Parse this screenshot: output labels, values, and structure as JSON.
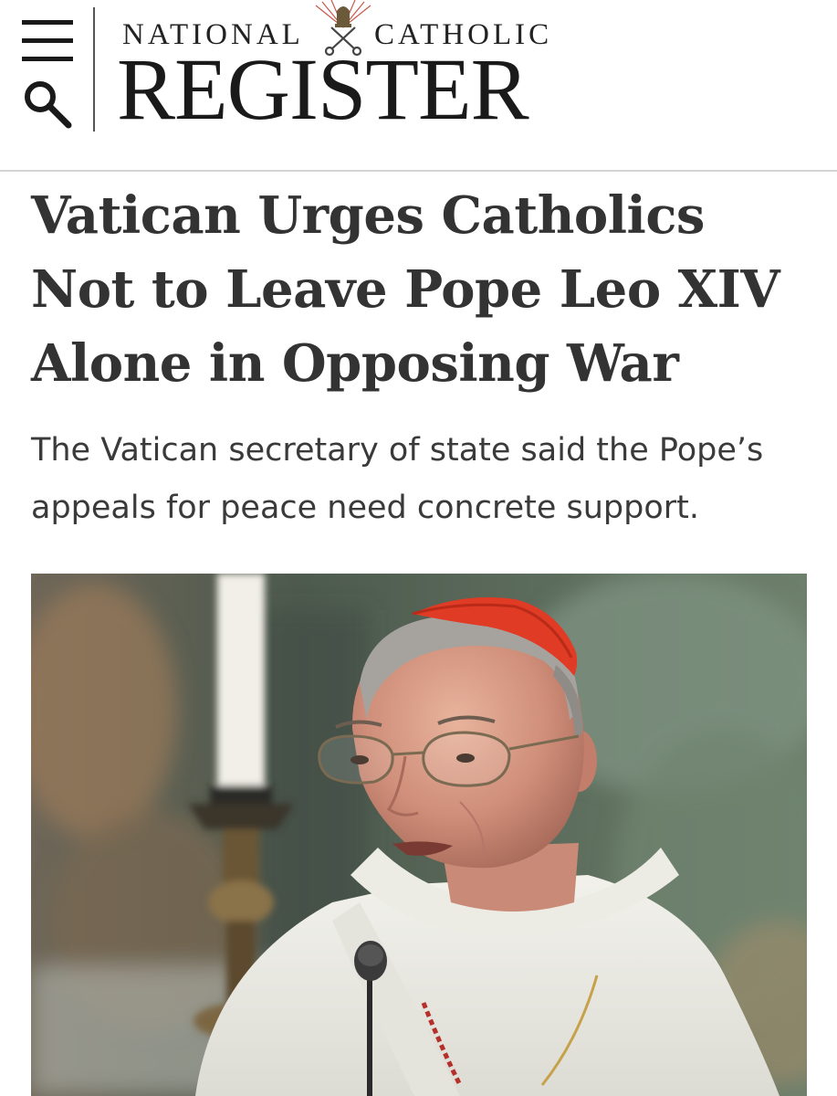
{
  "header": {
    "masthead_top_left": "NATIONAL",
    "masthead_top_right": "CATHOLIC",
    "masthead_main": "REGISTER",
    "menu_icon": "hamburger-menu-icon",
    "search_icon": "search-icon",
    "emblem_icon": "papal-keys-emblem-icon"
  },
  "article": {
    "headline": "Vatican Urges Catholics Not to Leave Pope Leo XIV Alone in Opposing War",
    "dek": "The Vatican secretary of state said the Pope’s appeals for peace need concrete support."
  },
  "colors": {
    "text": "#333333",
    "rule": "#d4d4d4",
    "zucchetto_red": "#e03b24"
  }
}
